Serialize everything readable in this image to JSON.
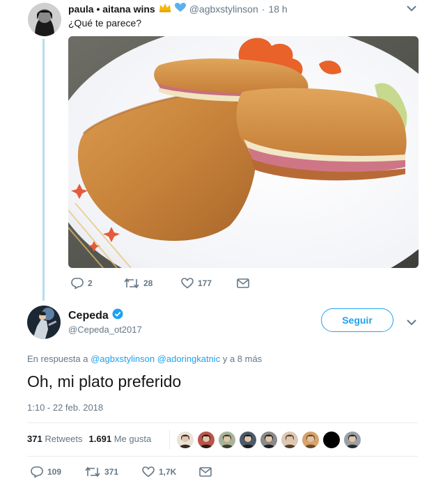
{
  "quoted_tweet": {
    "author_name": "paula • aitana wins",
    "emoji_icons": [
      "crown-icon",
      "blue-heart-icon"
    ],
    "handle": "@agbxstylinson",
    "separator": "·",
    "time": "18 h",
    "text": "¿Qué te parece?",
    "actions": {
      "replies": "2",
      "retweets": "28",
      "likes": "177"
    }
  },
  "main_tweet": {
    "author_name": "Cepeda",
    "verified": true,
    "handle": "@Cepeda_ot2017",
    "follow_label": "Seguir",
    "reply_prefix": "En respuesta a",
    "reply_users": [
      "@agbxstylinson",
      "@adoringkatnic"
    ],
    "reply_suffix": "y a 8 más",
    "text": "Oh, mi plato preferido",
    "timestamp": "1:10 - 22 feb. 2018",
    "stats": {
      "retweets_count": "371",
      "retweets_label": "Retweets",
      "likes_count": "1.691",
      "likes_label": "Me gusta"
    },
    "likers_count": 9,
    "actions": {
      "replies": "109",
      "retweets": "371",
      "likes": "1,7K"
    }
  },
  "colors": {
    "accent": "#1da1f2",
    "muted": "#657786",
    "thread_line": "#b4dcf2"
  }
}
